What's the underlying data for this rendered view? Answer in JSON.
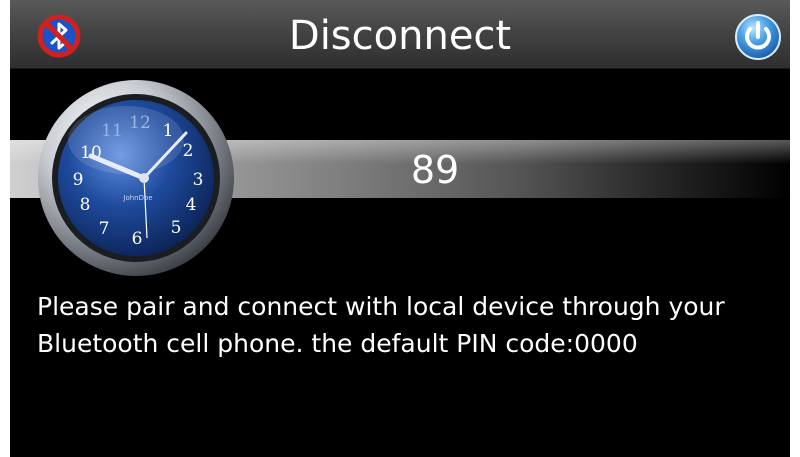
{
  "header": {
    "title": "Disconnect",
    "left_icon": "bluetooth-disabled-icon",
    "right_icon": "power-icon"
  },
  "status": {
    "counter": "89"
  },
  "clock": {
    "brand": "JohnDoe",
    "numerals": [
      "1",
      "2",
      "3",
      "4",
      "5",
      "6",
      "7",
      "8",
      "9",
      "10",
      "11",
      "12"
    ]
  },
  "message": {
    "line1": "Please pair and connect with local device through your",
    "line2": "Bluetooth cell phone. the default PIN code:0000"
  },
  "colors": {
    "background": "#000000",
    "header": "#444444",
    "text": "#ffffff",
    "clock_face": "#1e4a9c",
    "power_button": "#3a8fd8",
    "bt_prohibit": "#d02020"
  }
}
